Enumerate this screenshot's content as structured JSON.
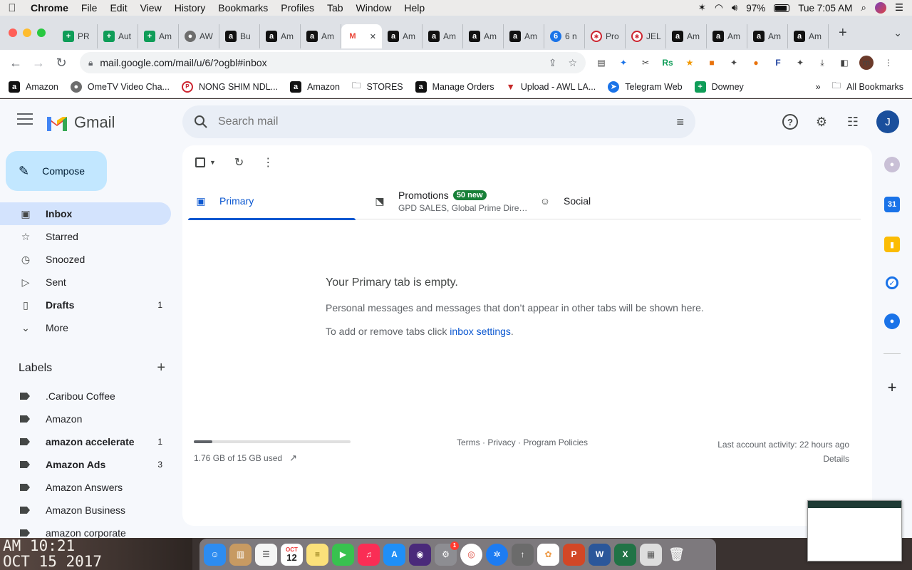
{
  "menubar": {
    "app": "Chrome",
    "items": [
      "File",
      "Edit",
      "View",
      "History",
      "Bookmarks",
      "Profiles",
      "Tab",
      "Window",
      "Help"
    ],
    "battery": "97%",
    "clock": "Tue 7:05 AM"
  },
  "tabs": [
    {
      "icon": "sheets-icon",
      "label": "PR"
    },
    {
      "icon": "sheets-icon",
      "label": "Aut"
    },
    {
      "icon": "sheets-icon",
      "label": "Am"
    },
    {
      "icon": "globe-icon",
      "label": "AW"
    },
    {
      "icon": "amazon-icon",
      "label": "Bu"
    },
    {
      "icon": "amazon-icon",
      "label": "Am"
    },
    {
      "icon": "amazon-icon",
      "label": "Am"
    },
    {
      "icon": "gmail-icon",
      "label": "",
      "active": true
    },
    {
      "icon": "amazon-icon",
      "label": "Am"
    },
    {
      "icon": "amazon-icon",
      "label": "Am"
    },
    {
      "icon": "amazon-icon",
      "label": "Am"
    },
    {
      "icon": "amazon-icon",
      "label": "Am"
    },
    {
      "icon": "number-icon",
      "label": "6 n"
    },
    {
      "icon": "pinwheel-icon",
      "label": "Pro"
    },
    {
      "icon": "pinwheel-icon",
      "label": "JEL"
    },
    {
      "icon": "amazon-icon",
      "label": "Am"
    },
    {
      "icon": "amazon-icon",
      "label": "Am"
    },
    {
      "icon": "amazon-icon",
      "label": "Am"
    },
    {
      "icon": "amazon-icon",
      "label": "Am"
    }
  ],
  "address": {
    "url": "mail.google.com/mail/u/6/?ogbl#inbox"
  },
  "bookmarks": [
    {
      "icon": "amazon-icon",
      "label": "Amazon"
    },
    {
      "icon": "globe-icon",
      "label": "OmeTV Video Cha..."
    },
    {
      "icon": "pinterest-icon",
      "label": "NONG SHIM NDL..."
    },
    {
      "icon": "amazon-icon",
      "label": "Amazon"
    },
    {
      "icon": "folder-icon",
      "label": "STORES"
    },
    {
      "icon": "amazon-icon",
      "label": "Manage Orders"
    },
    {
      "icon": "upload-icon",
      "label": "Upload - AWL LA..."
    },
    {
      "icon": "telegram-icon",
      "label": "Telegram Web"
    },
    {
      "icon": "sheets-icon",
      "label": "Downey"
    }
  ],
  "bookmarks_more": "»",
  "all_bookmarks": "All Bookmarks",
  "gmail": {
    "product": "Gmail",
    "search_placeholder": "Search mail",
    "account_initial": "J",
    "compose": "Compose",
    "nav": [
      {
        "icon": "inbox-icon",
        "label": "Inbox",
        "count": "",
        "active": true
      },
      {
        "icon": "star-icon",
        "label": "Starred",
        "count": ""
      },
      {
        "icon": "clock-icon",
        "label": "Snoozed",
        "count": ""
      },
      {
        "icon": "send-icon",
        "label": "Sent",
        "count": ""
      },
      {
        "icon": "draft-icon",
        "label": "Drafts",
        "count": "1",
        "bold": true
      },
      {
        "icon": "chevron-down-icon",
        "label": "More",
        "count": ""
      }
    ],
    "labels_title": "Labels",
    "labels": [
      {
        "label": ".Caribou Coffee",
        "count": ""
      },
      {
        "label": "Amazon",
        "count": ""
      },
      {
        "label": "amazon accelerate",
        "count": "1",
        "bold": true
      },
      {
        "label": "Amazon Ads",
        "count": "3",
        "bold": true
      },
      {
        "label": "Amazon Answers",
        "count": ""
      },
      {
        "label": "Amazon Business",
        "count": ""
      },
      {
        "label": "amazon corporate",
        "count": ""
      }
    ],
    "tabs": {
      "primary": "Primary",
      "promotions": "Promotions",
      "promotions_badge": "50 new",
      "promotions_sub": "GPD SALES, Global Prime Direct...",
      "social": "Social"
    },
    "empty": {
      "title": "Your Primary tab is empty.",
      "text": "Personal messages and messages that don’t appear in other tabs will be shown here.",
      "link_prefix": "To add or remove tabs click ",
      "link": "inbox settings",
      "link_suffix": "."
    },
    "footer": {
      "storage_used_fraction": 0.117,
      "storage": "1.76 GB of 15 GB used",
      "terms": "Terms",
      "privacy": "Privacy",
      "policies": "Program Policies",
      "sep": " · ",
      "activity": "Last account activity: 22 hours ago",
      "details": "Details"
    }
  },
  "desktop": {
    "line1": "AM 10:21",
    "line2": "OCT 15 2017"
  },
  "dock": {
    "calendar_month": "OCT",
    "calendar_day": "12",
    "settings_badge": "1"
  }
}
